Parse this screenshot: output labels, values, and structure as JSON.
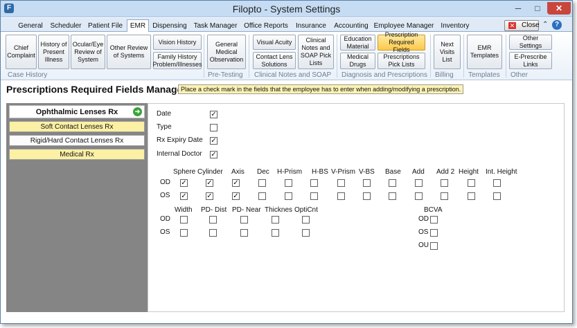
{
  "window": {
    "title": "Filopto - System Settings",
    "controls": {
      "minimize": "─",
      "maximize": "□",
      "close": "✕"
    }
  },
  "tabs": [
    {
      "label": "General"
    },
    {
      "label": "Scheduler"
    },
    {
      "label": "Patient File"
    },
    {
      "label": "EMR",
      "active": true
    },
    {
      "label": "Dispensing"
    },
    {
      "label": "Task Manager"
    },
    {
      "label": "Office Reports"
    },
    {
      "label": "Insurance"
    },
    {
      "label": "Accounting"
    },
    {
      "label": "Employee Manager"
    },
    {
      "label": "Inventory"
    }
  ],
  "toolbar": {
    "close_label": "Close",
    "close_glyph": "✕",
    "up_glyph": "⌃",
    "help_glyph": "?"
  },
  "ribbon": {
    "case_history": {
      "label": "Case History",
      "buttons": [
        "Chief Complaint",
        "History of Present Illness",
        "Ocular/Eye Review of System",
        "Other Review of Systems",
        "Vision History",
        "Family History Problem/Illnesses"
      ]
    },
    "pre_testing": {
      "label": "Pre-Testing",
      "buttons": [
        "General Medical Observation"
      ]
    },
    "clinical_notes": {
      "label": "Clinical Notes and SOAP",
      "buttons": [
        "Visual Acuity",
        "Contact Lens Solutions",
        "Clinical Notes and SOAP Pick Lists"
      ]
    },
    "diagnosis": {
      "label": "Diagnosis and Prescriptions",
      "buttons": [
        "Education Material",
        "Prescription Required Fields",
        "Medical Drugs",
        "Prescriptions Pick Lists"
      ]
    },
    "billing": {
      "label": "Billing",
      "buttons": [
        "Next Visits List"
      ]
    },
    "templates": {
      "label": "Templates",
      "buttons": [
        "EMR Templates"
      ]
    },
    "other": {
      "label": "Other",
      "buttons": [
        "Other Settings",
        "E-Prescribe Links"
      ]
    }
  },
  "page": {
    "title": "Prescriptions Required Fields Manager",
    "hint": "Place a check mark in the fields that the employee has to enter when adding/modifying a prescription."
  },
  "nav": {
    "items": [
      {
        "label": "Ophthalmic Lenses Rx",
        "selected": true
      },
      {
        "label": "Soft Contact Lenses Rx"
      },
      {
        "label": "Rigid/Hard Contact Lenses Rx"
      },
      {
        "label": "Medical Rx"
      }
    ],
    "arrow_glyph": "➔"
  },
  "form": {
    "check_glyph": "✓",
    "general_fields": [
      {
        "label": "Date",
        "checked": true
      },
      {
        "label": "Type",
        "checked": false
      },
      {
        "label": "Rx Expiry Date",
        "checked": true
      },
      {
        "label": "Internal Doctor",
        "checked": true
      }
    ],
    "grid1": {
      "columns": [
        "Sphere",
        "Cylinder",
        "Axis",
        "Dec",
        "H-Prism",
        "H-BS",
        "V-Prism",
        "V-BS",
        "Base",
        "Add",
        "Add 2",
        "Height",
        "Int. Height"
      ],
      "rows": [
        {
          "label": "OD",
          "checked": [
            true,
            true,
            true,
            false,
            false,
            false,
            false,
            false,
            false,
            false,
            false,
            false,
            false
          ]
        },
        {
          "label": "OS",
          "checked": [
            true,
            true,
            true,
            false,
            false,
            false,
            false,
            false,
            false,
            false,
            false,
            false,
            false
          ]
        }
      ]
    },
    "grid2": {
      "columns": [
        "Width",
        "PD- Dist",
        "PD- Near",
        "Thicknes",
        "OptiCnt"
      ],
      "rows": [
        {
          "label": "OD",
          "checked": [
            false,
            false,
            false,
            false,
            false
          ]
        },
        {
          "label": "OS",
          "checked": [
            false,
            false,
            false,
            false,
            false
          ]
        }
      ]
    },
    "bcva": {
      "title": "BCVA",
      "rows": [
        {
          "label": "OD",
          "checked": false
        },
        {
          "label": "OS",
          "checked": false
        },
        {
          "label": "OU",
          "checked": false
        }
      ]
    }
  }
}
